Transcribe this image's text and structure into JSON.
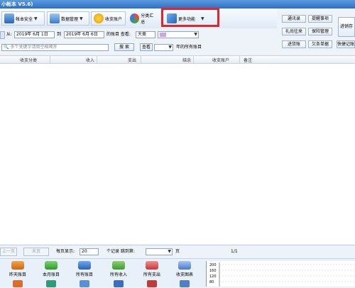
{
  "window": {
    "title": "小帐本 V5.6)"
  },
  "toolbar": {
    "account_security": "帐本安全",
    "data_management": "数据管理",
    "income_expense_account": "收支账户",
    "category_summary": "分类汇总",
    "more_functions": "更多功能"
  },
  "right_panel": {
    "address_book": "通讯录",
    "reminders": "提醒事项",
    "gift_exchange": "礼尚往来",
    "insurance_management": "保险管理",
    "shipping": "进货账",
    "loan_money": "欠条单据",
    "quick_query": "快捷记账",
    "enter_account": "进销存"
  },
  "filter": {
    "from_label": "从:",
    "date_from": "2019年 6月 1日",
    "to_label": "到",
    "date_to": "2019年 6月 6日",
    "view_label": "的账目 查看:",
    "category_value": "大类",
    "search_placeholder": "多个关键字请用空格隔开",
    "search_button": "搜 索",
    "view_button": "查看",
    "year_all_label": "年的所有账目"
  },
  "table": {
    "columns": [
      "收支分类",
      "收入",
      "支出",
      "结余",
      "收支账户",
      "备注"
    ]
  },
  "pager": {
    "prev_page": "上一页",
    "last_page": "末页",
    "per_page_label": "每页显示:",
    "per_page_value": "20",
    "records_label": "个记录 跳到第:",
    "page_label": "页",
    "page_indicator": "1/1"
  },
  "bottom_bar": {
    "items": [
      "昨天账目",
      "本月账目",
      "所有账目",
      "所有收入",
      "所有支出",
      "收支图表"
    ]
  },
  "mini_chart": {
    "y_ticks": [
      "200",
      "160",
      "120",
      "80"
    ]
  },
  "colors": {
    "highlight_box": "#e0252d",
    "title_bar": "#2f6fc2"
  }
}
